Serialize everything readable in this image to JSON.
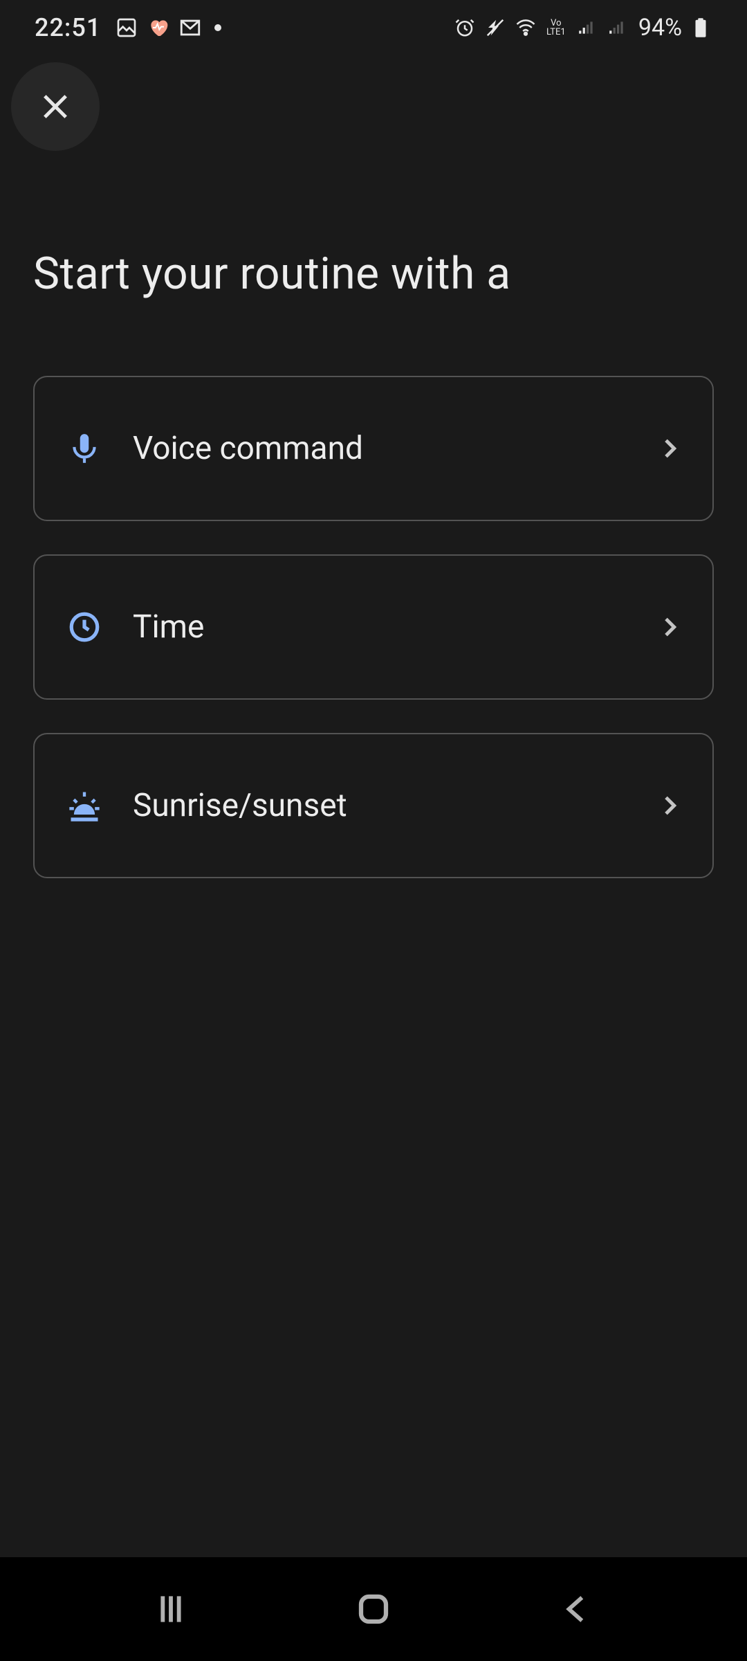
{
  "status": {
    "time": "22:51",
    "battery": "94%"
  },
  "page": {
    "title": "Start your routine with a"
  },
  "options": [
    {
      "label": "Voice command",
      "icon": "mic"
    },
    {
      "label": "Time",
      "icon": "clock"
    },
    {
      "label": "Sunrise/sunset",
      "icon": "sunrise"
    }
  ]
}
